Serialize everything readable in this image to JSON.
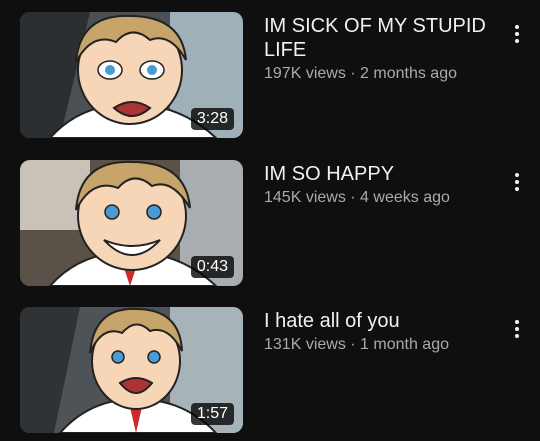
{
  "videos": [
    {
      "title": "IM SICK OF MY STUPID LIFE",
      "views": "197K views",
      "age": "2 months ago",
      "duration": "3:28"
    },
    {
      "title": "IM SO HAPPY",
      "views": "145K views",
      "age": "4 weeks ago",
      "duration": "0:43"
    },
    {
      "title": "I hate all of you",
      "views": "131K views",
      "age": "1 month ago",
      "duration": "1:57"
    }
  ],
  "separator": " · ",
  "icons": {
    "more": "more-vert-icon"
  },
  "colors": {
    "background": "#0f0f0f",
    "title": "#f1f1f1",
    "meta": "#aaaaaa"
  }
}
